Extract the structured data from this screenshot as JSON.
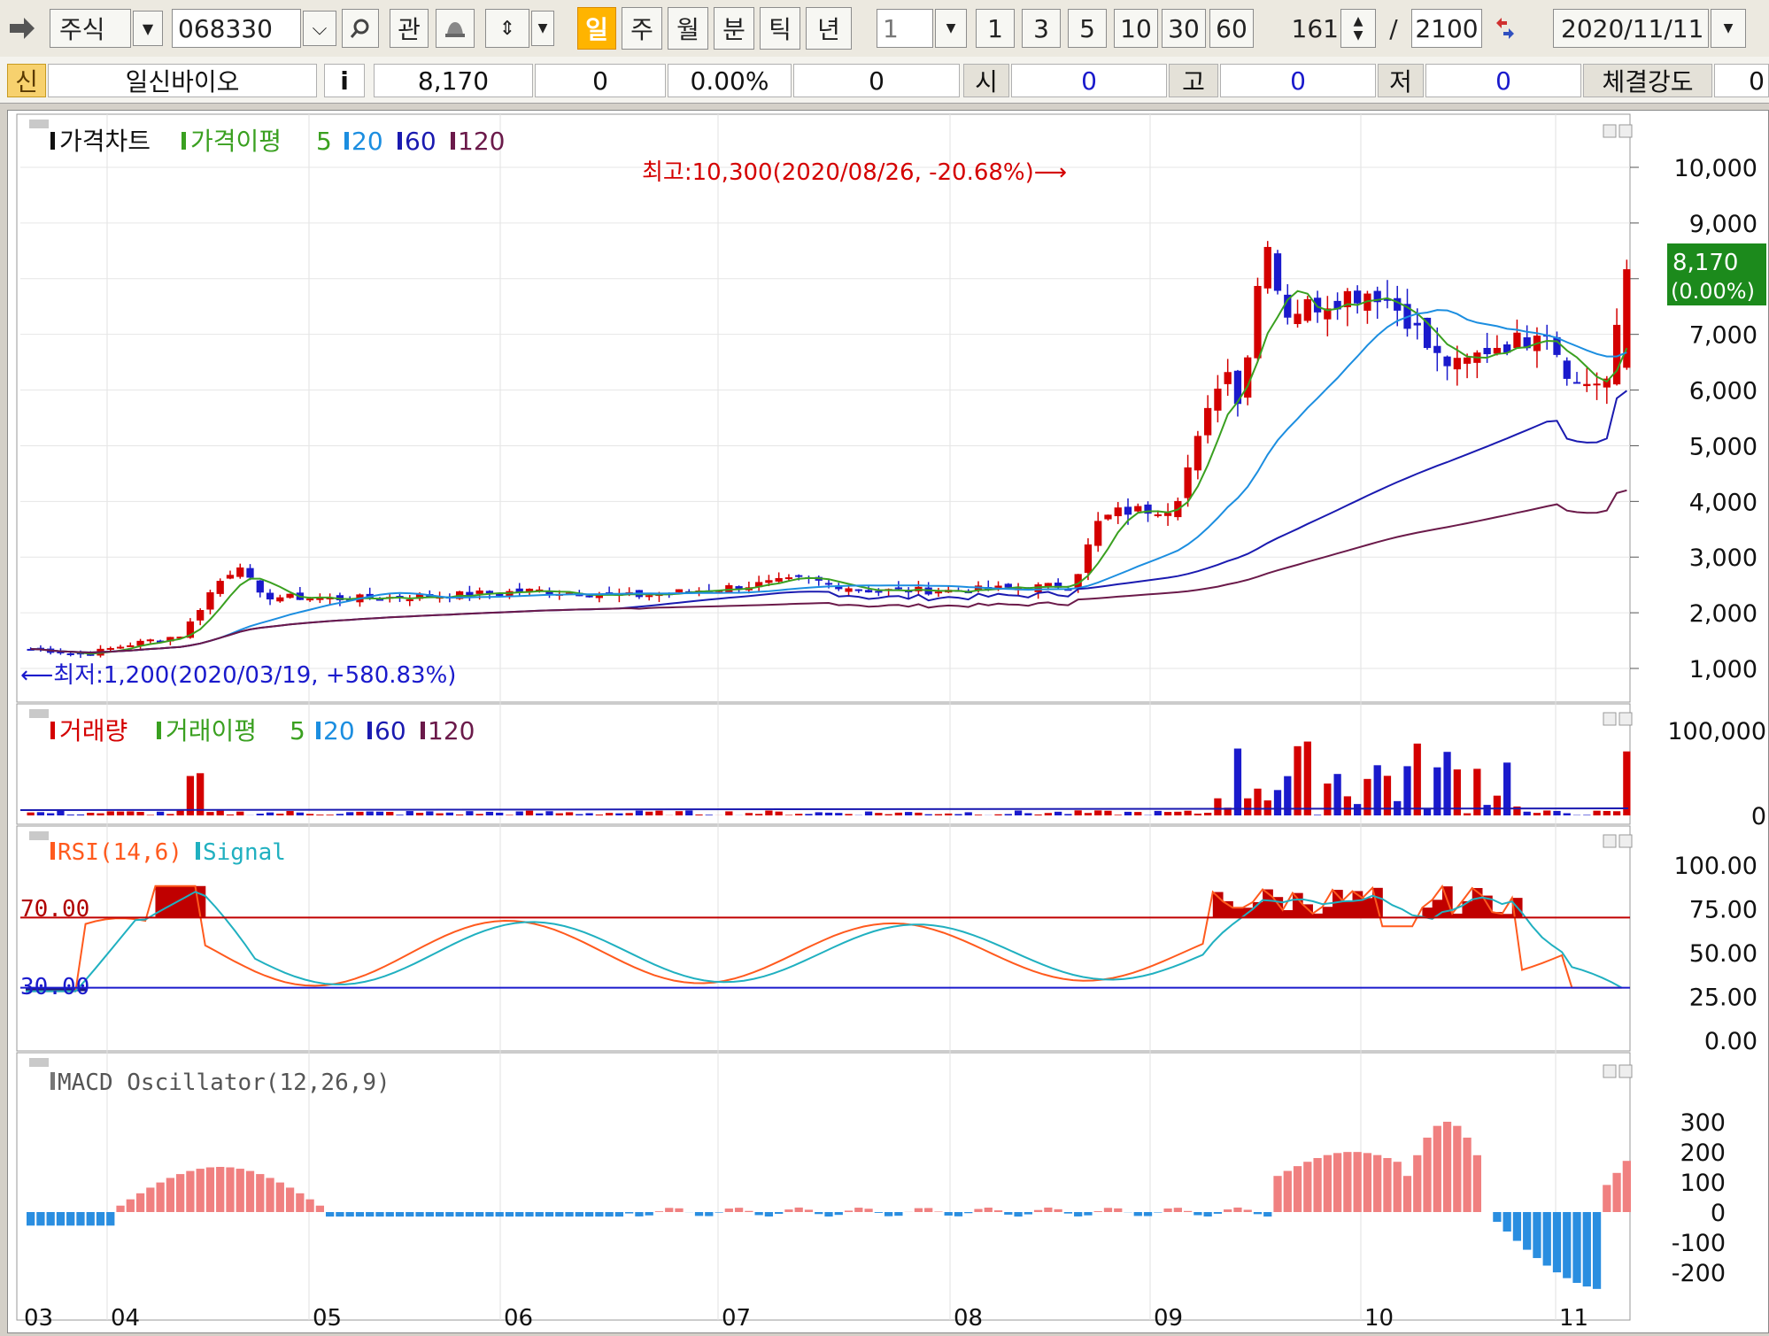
{
  "toolbar": {
    "market": "주식",
    "code": "068330",
    "icon_search": "search-icon",
    "btn_watch": "관",
    "periods": [
      "일",
      "주",
      "월",
      "분",
      "틱",
      "년"
    ],
    "active_period": "일",
    "interval_value": "1",
    "intervals": [
      "1",
      "3",
      "5",
      "10",
      "30",
      "60"
    ],
    "count": "161",
    "slash": "/",
    "total": "2100",
    "date": "2020/11/11"
  },
  "infobar": {
    "badge": "신",
    "name": "일신바이오",
    "info_icon": "i",
    "price": "8,170",
    "change": "0",
    "pct": "0.00%",
    "volume": "0",
    "open_label": "시",
    "open": "0",
    "high_label": "고",
    "high": "0",
    "low_label": "저",
    "low": "0",
    "strength_label": "체결강도",
    "strength": "0"
  },
  "panes": {
    "price": {
      "t1": "가격차트",
      "t2": "가격이평",
      "p5": "5",
      "p20": "20",
      "p60": "60",
      "p120": "120"
    },
    "volume": {
      "t1": "거래량",
      "t2": "거래이평",
      "p5": "5",
      "p20": "20",
      "p60": "60",
      "p120": "120"
    },
    "rsi": {
      "t1": "RSI(14,6)",
      "t2": "Signal"
    },
    "macd": {
      "t1": "MACD Oscillator(12,26,9)"
    }
  },
  "annotations": {
    "high": "최고:10,300(2020/08/26, -20.68%)⟶",
    "low": "⟵최저:1,200(2020/03/19, +580.83%)",
    "last_price": "8,170",
    "last_pct": "(0.00%)",
    "rsi_upper": "70.00",
    "rsi_lower": "30.00"
  },
  "axes": {
    "price": [
      "10,000",
      "9,000",
      "8,000",
      "7,000",
      "6,000",
      "5,000",
      "4,000",
      "3,000",
      "2,000",
      "1,000"
    ],
    "volume": [
      "100,000",
      "0"
    ],
    "rsi": [
      "100.00",
      "75.00",
      "50.00",
      "25.00",
      "0.00"
    ],
    "macd": [
      "300",
      "200",
      "100",
      "0",
      "-100",
      "-200"
    ],
    "months": [
      "03",
      "04",
      "05",
      "06",
      "07",
      "08",
      "09",
      "10",
      "11"
    ]
  },
  "colors": {
    "up": "#d40000",
    "down": "#1a1acc",
    "ma5": "#3aa020",
    "ma20": "#1c8ee0",
    "ma60": "#1a1ab0",
    "ma120": "#6b1a4a",
    "rsi": "#ff5a1e",
    "signal": "#20b0c0",
    "macd_pos": "#f08080",
    "macd_neg": "#2a8ee0",
    "accent": "#ffb400"
  },
  "chart_data": [
    {
      "type": "candlestick",
      "title": "가격차트",
      "ylim": [
        1000,
        10300
      ],
      "x": [
        "2020/03",
        "2020/04",
        "2020/05",
        "2020/06",
        "2020/07",
        "2020/08",
        "2020/09",
        "2020/10",
        "2020/11"
      ],
      "close_approx": [
        1300,
        2300,
        2350,
        2500,
        2500,
        7200,
        7300,
        6500,
        8170
      ],
      "high": {
        "value": 10300,
        "date": "2020/08/26"
      },
      "low": {
        "value": 1200,
        "date": "2020/03/19"
      },
      "last": 8170
    },
    {
      "type": "bar",
      "title": "거래량",
      "ylim": [
        0,
        100000
      ]
    },
    {
      "type": "line",
      "title": "RSI(14,6)",
      "ylim": [
        0,
        100
      ],
      "levels": [
        70,
        30
      ]
    },
    {
      "type": "bar",
      "title": "MACD Oscillator(12,26,9)",
      "ylim": [
        -300,
        300
      ]
    }
  ]
}
